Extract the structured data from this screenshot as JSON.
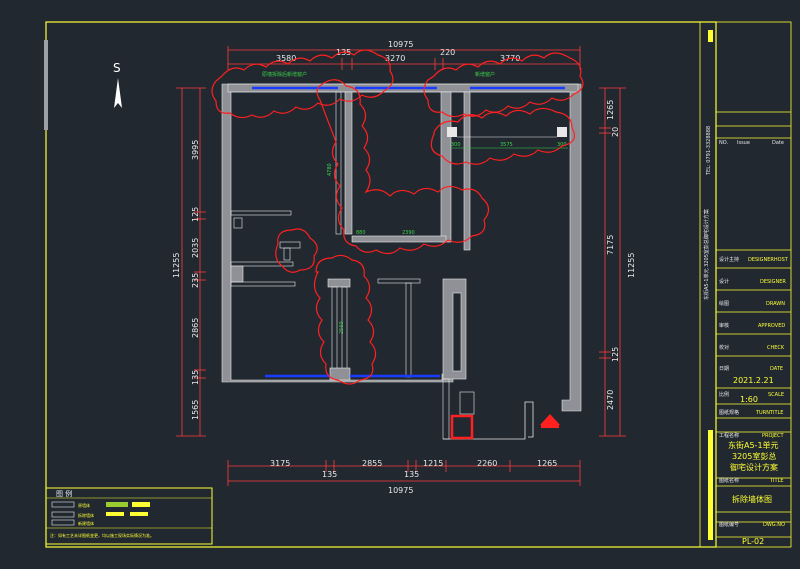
{
  "north": "S",
  "dims": {
    "top_total": "10975",
    "top": [
      "3580",
      "135",
      "3270",
      "220",
      "3770"
    ],
    "bottom_total": "10975",
    "bottom": [
      "3175",
      "135",
      "2855",
      "135",
      "1215",
      "2260",
      "1265"
    ],
    "left_total": "11255",
    "left": [
      "3995",
      "125",
      "2035",
      "235",
      "2865",
      "135",
      "1565"
    ],
    "right_total": "11255",
    "right_upper": [
      "1265",
      "20"
    ],
    "right_lower": [
      "7175",
      "125",
      "2470"
    ]
  },
  "inner": {
    "top_notes": [
      "原墙拆除后新增窗户",
      "新增窗户"
    ],
    "mid": [
      "880",
      "2390",
      "4780",
      "3575",
      "300",
      "300",
      "2560"
    ]
  },
  "title_block": {
    "vertical_info": "东街A5-1单元 3205室彭总御宅设计方案",
    "tel": "TEL: 0791-3328888",
    "no_label": "NO.",
    "issue_label": "Issue",
    "date_label": "Date",
    "rows": [
      {
        "cn": "设计主持",
        "en": "DESIGNERHOST"
      },
      {
        "cn": "设计",
        "en": "DESIGNER"
      },
      {
        "cn": "绘图",
        "en": "DRAWN"
      },
      {
        "cn": "审核",
        "en": "APPROVED"
      },
      {
        "cn": "校对",
        "en": "CHECK"
      },
      {
        "cn": "日期",
        "en": "DATE"
      }
    ],
    "date_value": "2021.2.21",
    "scale_cn": "比例",
    "scale_en": "SCALE",
    "scale_value": "1:60",
    "sheet_cn": "图纸规格",
    "sheet_en": "TURNTITLE",
    "project_cn": "工程名称",
    "project_en": "PROJECT",
    "project_lines": [
      "东街A5-1单元",
      "3205室彭总",
      "御宅设计方案"
    ],
    "title_cn": "图纸名称",
    "title_en": "TITLE",
    "title_value": "拆除墙体图",
    "dwg_cn": "图纸编号",
    "dwg_en": "DWG.NO",
    "dwg_value": "PL-02"
  },
  "legend": {
    "title": "图 例",
    "items": [
      "原墙体",
      "拆除墙体",
      "新建墙体"
    ],
    "note": "注：如有工艺未详图纸变更，均以施工现场实际情况为准。"
  }
}
